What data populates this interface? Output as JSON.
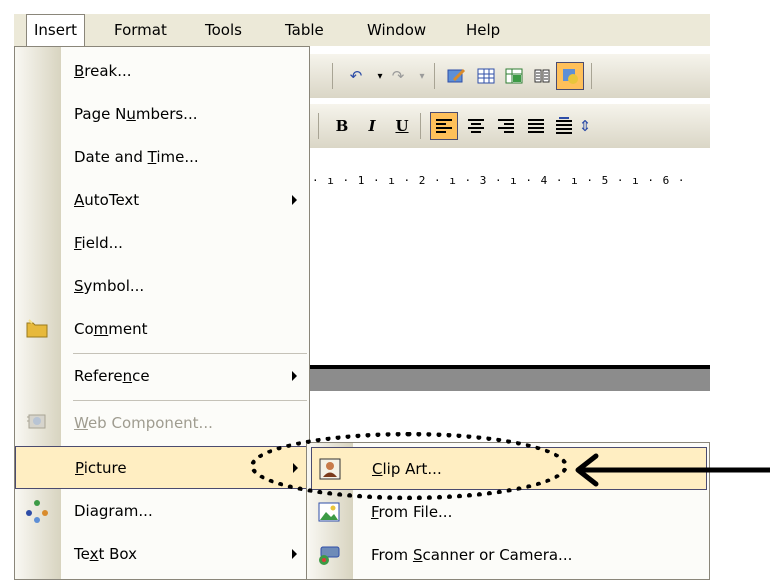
{
  "menubar": {
    "items": [
      {
        "label": "Insert"
      },
      {
        "label": "Format"
      },
      {
        "label": "Tools"
      },
      {
        "label": "Table"
      },
      {
        "label": "Window"
      },
      {
        "label": "Help"
      }
    ]
  },
  "ruler": {
    "scale": "· ı · 1 · ı · 2 · ı · 3 · ı · 4 · ı · 5 · ı · 6 ·"
  },
  "format_toolbar": {
    "bold": "B",
    "italic": "I",
    "underline": "U"
  },
  "insert_menu": {
    "items": [
      {
        "label": "Break...",
        "mnemonic": "B"
      },
      {
        "label": "Page Numbers...",
        "mnemonic": "u"
      },
      {
        "label": "Date and Time...",
        "mnemonic": "T"
      },
      {
        "label": "AutoText",
        "mnemonic": "A",
        "submenu": true
      },
      {
        "label": "Field...",
        "mnemonic": "F"
      },
      {
        "label": "Symbol...",
        "mnemonic": "S"
      },
      {
        "label": "Comment",
        "mnemonic": "m",
        "icon": "comment-icon"
      },
      {
        "label": "Reference",
        "mnemonic": "n",
        "submenu": true
      },
      {
        "label": "Web Component...",
        "mnemonic": "W",
        "disabled": true,
        "icon": "web-component-icon"
      },
      {
        "label": "Picture",
        "mnemonic": "P",
        "submenu": true,
        "highlighted": true
      },
      {
        "label": "Diagram...",
        "icon": "diagram-icon"
      },
      {
        "label": "Text Box",
        "mnemonic": "x",
        "submenu": true
      }
    ]
  },
  "picture_submenu": {
    "items": [
      {
        "label": "Clip Art...",
        "mnemonic": "C",
        "icon": "clip-art-icon",
        "highlighted": true
      },
      {
        "label": "From File...",
        "mnemonic": "F",
        "icon": "from-file-icon"
      },
      {
        "label": "From Scanner or Camera...",
        "mnemonic": "S",
        "icon": "scanner-camera-icon"
      }
    ]
  },
  "colors": {
    "menu_highlight": "#FFEEC2",
    "menu_border": "#8A867A",
    "menubar_bg": "#ECE9D8",
    "disabled_text": "#9F9C90"
  }
}
